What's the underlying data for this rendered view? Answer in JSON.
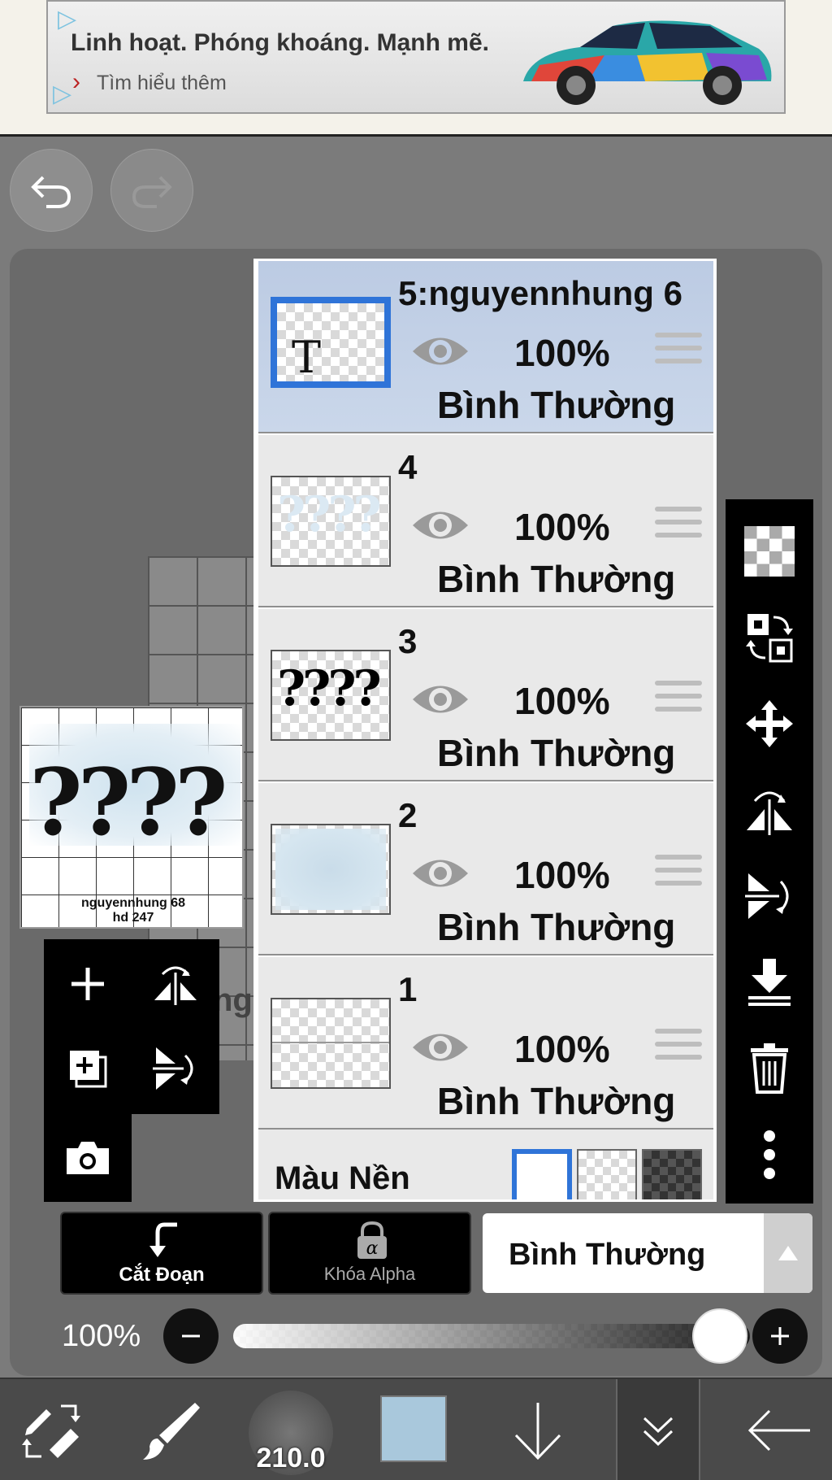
{
  "ad": {
    "headline": "Linh hoạt. Phóng khoáng. Mạnh mẽ.",
    "cta": "Tìm hiểu thêm"
  },
  "thumbnail": {
    "glyphs": "????",
    "caption_line1": "nguyennhung 68",
    "caption_line2": "hd 247"
  },
  "canvas": {
    "partial_text": "ngu"
  },
  "layers": [
    {
      "name": "5:nguyennhung 6",
      "opacity": "100%",
      "blend": "Bình Thường",
      "thumb_text": "T",
      "selected": true
    },
    {
      "name": "4",
      "opacity": "100%",
      "blend": "Bình Thường",
      "thumb_text": "????",
      "selected": false
    },
    {
      "name": "3",
      "opacity": "100%",
      "blend": "Bình Thường",
      "thumb_text": "????",
      "selected": false
    },
    {
      "name": "2",
      "opacity": "100%",
      "blend": "Bình Thường",
      "thumb_text": "",
      "selected": false
    },
    {
      "name": "1",
      "opacity": "100%",
      "blend": "Bình Thường",
      "thumb_text": "",
      "selected": false
    }
  ],
  "background_color": {
    "label": "Màu Nền",
    "selected": "white"
  },
  "controls": {
    "clip_label": "Cắt Đoạn",
    "alpha_lock_label": "Khóa Alpha",
    "blend_mode_value": "Bình Thường",
    "opacity_label": "100%",
    "opacity_value": 1.0
  },
  "toolbar": {
    "brush_size": "210.0",
    "current_color": "#a9c8dc"
  },
  "colors": {
    "selection_blue": "#2f74d8",
    "selected_layer_bg": "#c4d2e8",
    "panel_black": "#000000"
  }
}
